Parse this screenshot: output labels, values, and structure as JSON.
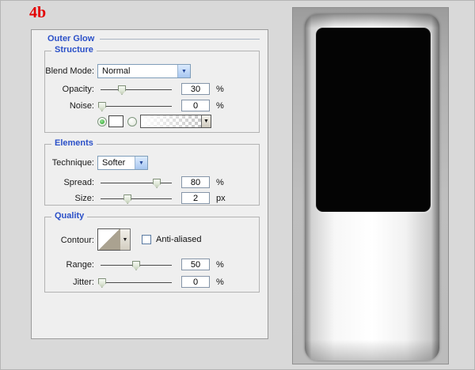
{
  "figure_label": "4b",
  "colors": {
    "accent_blue": "#2b50c8",
    "label_red": "#e30000",
    "device_screen": "#040404"
  },
  "panel": {
    "title": "Outer Glow",
    "structure": {
      "legend": "Structure",
      "blend_mode": {
        "label": "Blend Mode:",
        "value": "Normal"
      },
      "opacity": {
        "label": "Opacity:",
        "value": "30",
        "unit": "%"
      },
      "noise": {
        "label": "Noise:",
        "value": "0",
        "unit": "%"
      }
    },
    "elements": {
      "legend": "Elements",
      "technique": {
        "label": "Technique:",
        "value": "Softer"
      },
      "spread": {
        "label": "Spread:",
        "value": "80",
        "unit": "%"
      },
      "size": {
        "label": "Size:",
        "value": "2",
        "unit": "px"
      }
    },
    "quality": {
      "legend": "Quality",
      "contour": {
        "label": "Contour:"
      },
      "anti_aliased": {
        "label": "Anti-aliased",
        "checked": false
      },
      "range": {
        "label": "Range:",
        "value": "50",
        "unit": "%"
      },
      "jitter": {
        "label": "Jitter:",
        "value": "0",
        "unit": "%"
      }
    }
  },
  "sliders": {
    "opacity": 30,
    "noise": 2,
    "spread": 79,
    "size": 38,
    "range": 50,
    "jitter": 2
  }
}
